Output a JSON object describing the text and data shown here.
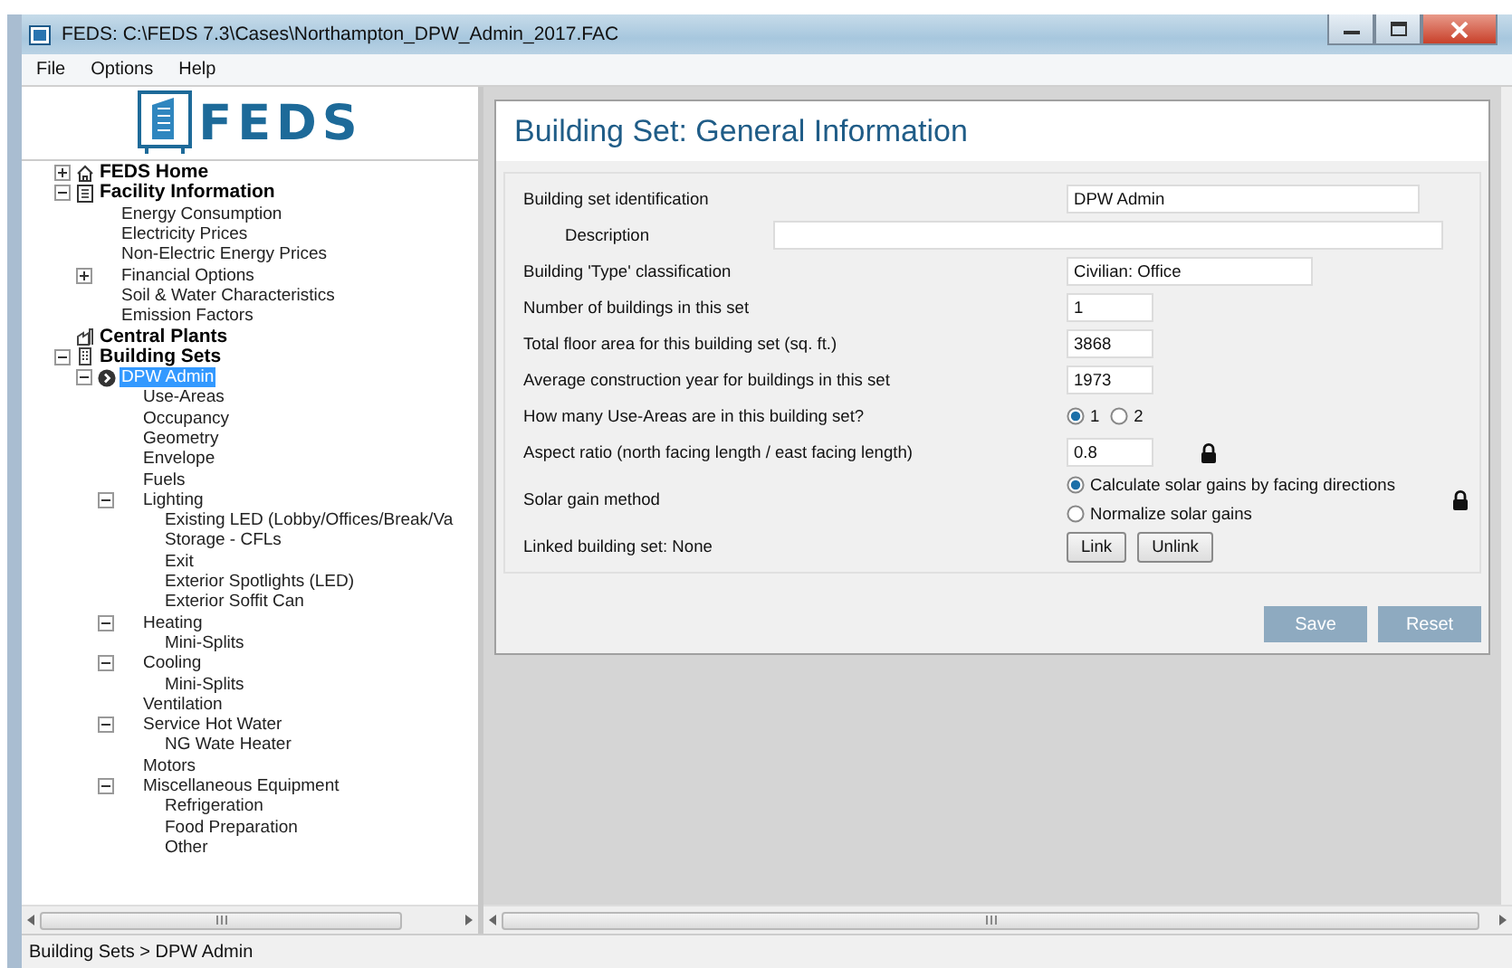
{
  "window": {
    "title": "FEDS: C:\\FEDS 7.3\\Cases\\Northampton_DPW_Admin_2017.FAC"
  },
  "menu": [
    "File",
    "Options",
    "Help"
  ],
  "logo": {
    "text": "FEDS"
  },
  "tree": [
    {
      "label": "FEDS Home",
      "kind": "home",
      "expanded": false,
      "selected": false
    },
    {
      "label": "Facility Information",
      "kind": "document",
      "expanded": true,
      "selected": false,
      "children": [
        {
          "label": "Energy Consumption",
          "selected": false
        },
        {
          "label": "Electricity Prices",
          "selected": false
        },
        {
          "label": "Non-Electric Energy Prices",
          "selected": false
        },
        {
          "label": "Financial Options",
          "expanded": false,
          "selected": false
        },
        {
          "label": "Soil & Water Characteristics",
          "selected": false
        },
        {
          "label": "Emission Factors",
          "selected": false
        }
      ]
    },
    {
      "label": "Central Plants",
      "kind": "plant",
      "selected": false
    },
    {
      "label": "Building Sets",
      "kind": "building",
      "expanded": true,
      "selected": false,
      "children": [
        {
          "label": "DPW Admin",
          "kind": "current",
          "expanded": true,
          "selected": true,
          "children": [
            {
              "label": "Use-Areas",
              "selected": false
            },
            {
              "label": "Occupancy",
              "selected": false
            },
            {
              "label": "Geometry",
              "selected": false
            },
            {
              "label": "Envelope",
              "selected": false
            },
            {
              "label": "Fuels",
              "selected": false
            },
            {
              "label": "Lighting",
              "expanded": true,
              "selected": false,
              "children": [
                {
                  "label": "Existing LED (Lobby/Offices/Break/Va",
                  "selected": false
                },
                {
                  "label": "Storage - CFLs",
                  "selected": false
                },
                {
                  "label": "Exit",
                  "selected": false
                },
                {
                  "label": "Exterior Spotlights (LED)",
                  "selected": false
                },
                {
                  "label": "Exterior Soffit Can",
                  "selected": false
                }
              ]
            },
            {
              "label": "Heating",
              "expanded": true,
              "selected": false,
              "children": [
                {
                  "label": "Mini-Splits",
                  "selected": false
                }
              ]
            },
            {
              "label": "Cooling",
              "expanded": true,
              "selected": false,
              "children": [
                {
                  "label": "Mini-Splits",
                  "selected": false
                }
              ]
            },
            {
              "label": "Ventilation",
              "selected": false
            },
            {
              "label": "Service Hot Water",
              "expanded": true,
              "selected": false,
              "children": [
                {
                  "label": "NG Wate Heater",
                  "selected": false
                }
              ]
            },
            {
              "label": "Motors",
              "selected": false
            },
            {
              "label": "Miscellaneous Equipment",
              "expanded": true,
              "selected": false,
              "children": [
                {
                  "label": "Refrigeration",
                  "selected": false
                },
                {
                  "label": "Food Preparation",
                  "selected": false
                },
                {
                  "label": "Other",
                  "selected": false
                }
              ]
            }
          ]
        }
      ]
    }
  ],
  "page": {
    "title": "Building Set:  General Information",
    "fields": [
      {
        "kind": "wide",
        "label": "Building set identification",
        "value": "DPW Admin"
      },
      {
        "kind": "description",
        "label": "Description"
      },
      {
        "kind": "medium",
        "label": "Building 'Type' classification",
        "value": "Civilian: Office"
      },
      {
        "kind": "short",
        "label": "Number of buildings in this set",
        "value": "1"
      },
      {
        "kind": "short",
        "label": "Total floor area for this building set (sq. ft.)",
        "value": "3868"
      },
      {
        "kind": "short",
        "label": "Average construction year for buildings in this set",
        "value": "1973"
      },
      {
        "kind": "radio-inline",
        "label": "How many Use-Areas are in this building set?",
        "options": [
          {
            "label": "1",
            "selected": true
          },
          {
            "label": "2",
            "selected": false
          }
        ]
      },
      {
        "kind": "short",
        "label": "Aspect ratio (north facing length / east facing length)",
        "value": "0.8",
        "locked": true
      },
      {
        "kind": "radio-stack",
        "label": "Solar gain method",
        "locked": true,
        "options": [
          {
            "label": "Calculate solar gains by facing directions",
            "selected": true
          },
          {
            "label": "Normalize solar gains",
            "selected": false
          }
        ]
      },
      {
        "kind": "buttons",
        "label": "Linked building set: None",
        "buttons": [
          "Link",
          "Unlink"
        ]
      }
    ],
    "buttons": [
      {
        "label": "Save",
        "disabled": true
      },
      {
        "label": "Reset",
        "disabled": true
      }
    ]
  },
  "status_bar": "Building Sets > DPW Admin"
}
